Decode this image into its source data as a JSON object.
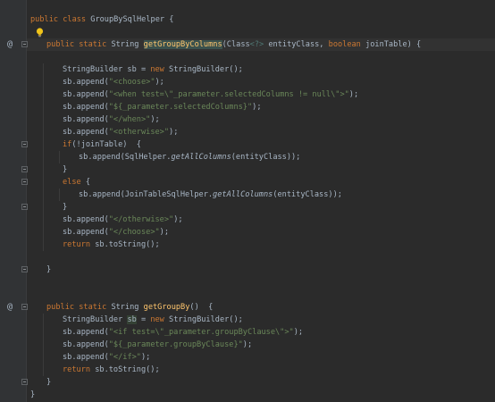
{
  "editor": {
    "lines": [
      {
        "indent": 0,
        "tokens": [
          {
            "t": "public ",
            "c": "kw"
          },
          {
            "t": "class ",
            "c": "kw"
          },
          {
            "t": "GroupBySqlHelper {",
            "c": ""
          }
        ]
      },
      {
        "indent": 0,
        "tokens": []
      },
      {
        "indent": 1,
        "tokens": [
          {
            "t": "public ",
            "c": "kw"
          },
          {
            "t": "static ",
            "c": "kw"
          },
          {
            "t": "String ",
            "c": ""
          },
          {
            "t": "getGroupByColumns",
            "c": "fn hl-name"
          },
          {
            "t": "(Class",
            "c": ""
          },
          {
            "t": "<?>",
            "c": "gen"
          },
          {
            "t": " entityClass, ",
            "c": ""
          },
          {
            "t": "boolean ",
            "c": "kw"
          },
          {
            "t": "joinTable) {",
            "c": ""
          }
        ]
      },
      {
        "indent": 0,
        "tokens": []
      },
      {
        "indent": 2,
        "tokens": [
          {
            "t": "StringBuilder sb = ",
            "c": ""
          },
          {
            "t": "new ",
            "c": "kw"
          },
          {
            "t": "StringBuilder();",
            "c": ""
          }
        ]
      },
      {
        "indent": 2,
        "tokens": [
          {
            "t": "sb.append(",
            "c": ""
          },
          {
            "t": "\"<choose>\"",
            "c": "str"
          },
          {
            "t": ");",
            "c": ""
          }
        ]
      },
      {
        "indent": 2,
        "tokens": [
          {
            "t": "sb.append(",
            "c": ""
          },
          {
            "t": "\"<when test=\\\"_parameter.selectedColumns != null\\\">\"",
            "c": "str"
          },
          {
            "t": ");",
            "c": ""
          }
        ]
      },
      {
        "indent": 2,
        "tokens": [
          {
            "t": "sb.append(",
            "c": ""
          },
          {
            "t": "\"${_parameter.selectedColumns}\"",
            "c": "str"
          },
          {
            "t": ");",
            "c": ""
          }
        ]
      },
      {
        "indent": 2,
        "tokens": [
          {
            "t": "sb.append(",
            "c": ""
          },
          {
            "t": "\"</when>\"",
            "c": "str"
          },
          {
            "t": ");",
            "c": ""
          }
        ]
      },
      {
        "indent": 2,
        "tokens": [
          {
            "t": "sb.append(",
            "c": ""
          },
          {
            "t": "\"<otherwise>\"",
            "c": "str"
          },
          {
            "t": ");",
            "c": ""
          }
        ]
      },
      {
        "indent": 2,
        "tokens": [
          {
            "t": "if",
            "c": "kw"
          },
          {
            "t": "(!joinTable)  {",
            "c": ""
          }
        ]
      },
      {
        "indent": 3,
        "tokens": [
          {
            "t": "sb.append(SqlHelper.",
            "c": ""
          },
          {
            "t": "getAllColumns",
            "c": "it"
          },
          {
            "t": "(entityClass));",
            "c": ""
          }
        ]
      },
      {
        "indent": 2,
        "tokens": [
          {
            "t": "}",
            "c": ""
          }
        ]
      },
      {
        "indent": 2,
        "tokens": [
          {
            "t": "else ",
            "c": "kw"
          },
          {
            "t": "{",
            "c": ""
          }
        ]
      },
      {
        "indent": 3,
        "tokens": [
          {
            "t": "sb.append(JoinTableSqlHelper.",
            "c": ""
          },
          {
            "t": "getAllColumns",
            "c": "it"
          },
          {
            "t": "(entityClass));",
            "c": ""
          }
        ]
      },
      {
        "indent": 2,
        "tokens": [
          {
            "t": "}",
            "c": ""
          }
        ]
      },
      {
        "indent": 2,
        "tokens": [
          {
            "t": "sb.append(",
            "c": ""
          },
          {
            "t": "\"</otherwise>\"",
            "c": "str"
          },
          {
            "t": ");",
            "c": ""
          }
        ]
      },
      {
        "indent": 2,
        "tokens": [
          {
            "t": "sb.append(",
            "c": ""
          },
          {
            "t": "\"</choose>\"",
            "c": "str"
          },
          {
            "t": ");",
            "c": ""
          }
        ]
      },
      {
        "indent": 2,
        "tokens": [
          {
            "t": "return ",
            "c": "kw"
          },
          {
            "t": "sb.toString();",
            "c": ""
          }
        ]
      },
      {
        "indent": 0,
        "tokens": []
      },
      {
        "indent": 1,
        "tokens": [
          {
            "t": "}",
            "c": ""
          }
        ]
      },
      {
        "indent": 0,
        "tokens": []
      },
      {
        "indent": 0,
        "tokens": []
      },
      {
        "indent": 1,
        "tokens": [
          {
            "t": "public ",
            "c": "kw"
          },
          {
            "t": "static ",
            "c": "kw"
          },
          {
            "t": "String ",
            "c": ""
          },
          {
            "t": "getGroupBy",
            "c": "fn"
          },
          {
            "t": "()  {",
            "c": ""
          }
        ]
      },
      {
        "indent": 2,
        "tokens": [
          {
            "t": "StringBuilder ",
            "c": ""
          },
          {
            "t": "sb",
            "c": "hl-var"
          },
          {
            "t": " = ",
            "c": ""
          },
          {
            "t": "new ",
            "c": "kw"
          },
          {
            "t": "StringBuilder();",
            "c": ""
          }
        ]
      },
      {
        "indent": 2,
        "tokens": [
          {
            "t": "sb.append(",
            "c": ""
          },
          {
            "t": "\"<if test=\\\"_parameter.groupByClause\\\">\"",
            "c": "str"
          },
          {
            "t": ");",
            "c": ""
          }
        ]
      },
      {
        "indent": 2,
        "tokens": [
          {
            "t": "sb.append(",
            "c": ""
          },
          {
            "t": "\"${_parameter.groupByClause}\"",
            "c": "str"
          },
          {
            "t": ");",
            "c": ""
          }
        ]
      },
      {
        "indent": 2,
        "tokens": [
          {
            "t": "sb.append(",
            "c": ""
          },
          {
            "t": "\"</if>\"",
            "c": "str"
          },
          {
            "t": ");",
            "c": ""
          }
        ]
      },
      {
        "indent": 2,
        "tokens": [
          {
            "t": "return ",
            "c": "kw"
          },
          {
            "t": "sb.toString();",
            "c": ""
          }
        ]
      },
      {
        "indent": 1,
        "tokens": [
          {
            "t": "}",
            "c": ""
          }
        ]
      },
      {
        "indent": 0,
        "tokens": [
          {
            "t": "}",
            "c": ""
          }
        ]
      }
    ]
  },
  "gutter": {
    "override_marker": "@",
    "override_lines": [
      2,
      23
    ],
    "fold_lines": [
      2,
      10,
      12,
      13,
      15,
      20,
      23,
      29
    ],
    "current_line": 2,
    "intention_icon": "lightbulb-icon"
  },
  "colors": {
    "background": "#2b2b2b",
    "gutter": "#313335",
    "keyword": "#cc7832",
    "string": "#6a8759",
    "method": "#ffc66d",
    "text": "#a9b7c6"
  }
}
